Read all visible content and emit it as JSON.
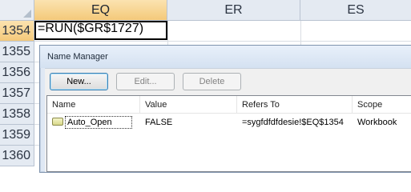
{
  "spreadsheet": {
    "columns": [
      "EQ",
      "ER",
      "ES"
    ],
    "rows": [
      "1354",
      "1355",
      "1356",
      "1357",
      "1358",
      "1359",
      "1360"
    ],
    "active_cell_value": "=RUN($GR$1727)"
  },
  "dialog": {
    "title": "Name Manager",
    "buttons": {
      "new": "New...",
      "edit": "Edit...",
      "delete": "Delete"
    },
    "list": {
      "headers": [
        "Name",
        "Value",
        "Refers To",
        "Scope"
      ],
      "rows": [
        {
          "name": "Auto_Open",
          "value": "FALSE",
          "refers_to": "=sygfdfdfdesie!$EQ$1354",
          "scope": "Workbook"
        }
      ]
    }
  }
}
